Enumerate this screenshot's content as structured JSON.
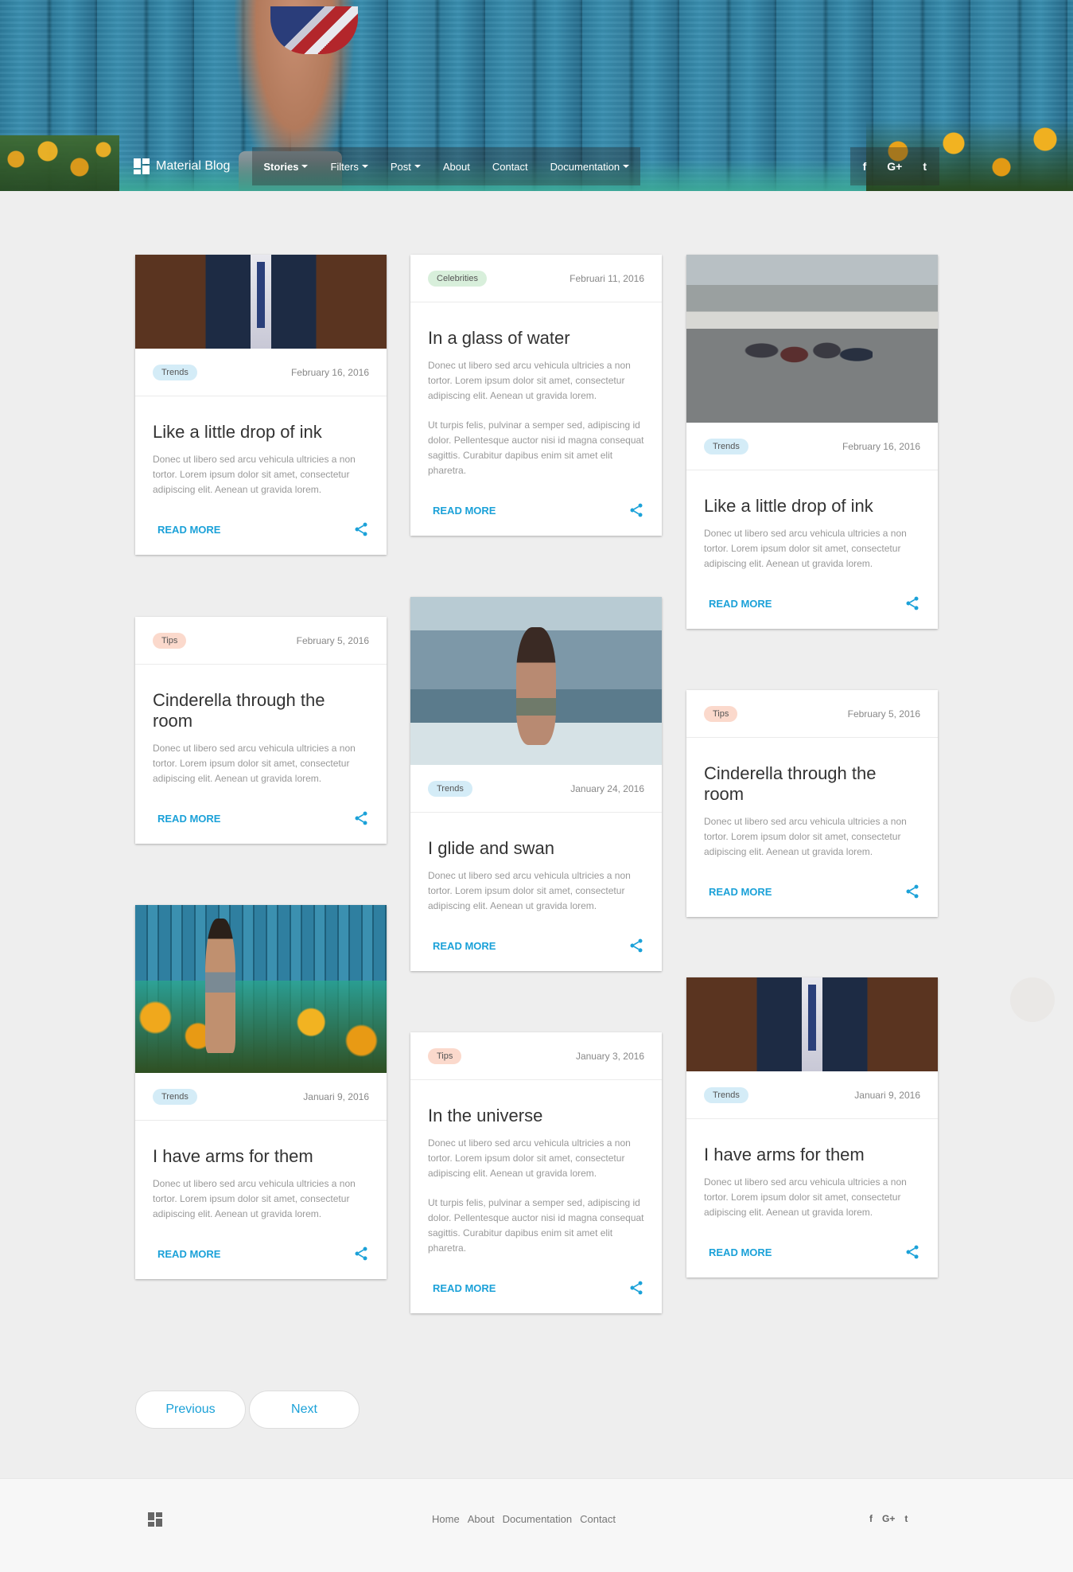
{
  "brand": "Material Blog",
  "nav": [
    {
      "label": "Stories",
      "dropdown": true,
      "active": true
    },
    {
      "label": "Filters",
      "dropdown": true
    },
    {
      "label": "Post",
      "dropdown": true
    },
    {
      "label": "About",
      "dropdown": false
    },
    {
      "label": "Contact",
      "dropdown": false
    },
    {
      "label": "Documentation",
      "dropdown": true
    }
  ],
  "social": [
    "f",
    "G+",
    "t"
  ],
  "colors": {
    "accent": "#1ba1d8",
    "trends": "#d4ecf7",
    "tips": "#fbd9cc",
    "celebrities": "#d8efdb"
  },
  "cards": [
    {
      "category": "Trends",
      "date": "February 16, 2016",
      "title": "Like a little drop of ink",
      "body": [
        "Donec ut libero sed arcu vehicula ultricies a non tortor. Lorem ipsum dolor sit amet, consectetur adipiscing elit. Aenean ut gravida lorem."
      ],
      "read_more": "READ MORE",
      "image": "suit"
    },
    {
      "category": "Tips",
      "date": "February 5, 2016",
      "title": "Cinderella through the room",
      "body": [
        "Donec ut libero sed arcu vehicula ultricies a non tortor. Lorem ipsum dolor sit amet, consectetur adipiscing elit. Aenean ut gravida lorem."
      ],
      "read_more": "READ MORE",
      "image": ""
    },
    {
      "category": "Trends",
      "date": "Januari 9, 2016",
      "title": "I have arms for them",
      "body": [
        "Donec ut libero sed arcu vehicula ultricies a non tortor. Lorem ipsum dolor sit amet, consectetur adipiscing elit. Aenean ut gravida lorem."
      ],
      "read_more": "READ MORE",
      "image": "fence"
    },
    {
      "category": "Celebrities",
      "date": "Februari 11, 2016",
      "title": "In a glass of water",
      "body": [
        "Donec ut libero sed arcu vehicula ultricies a non tortor. Lorem ipsum dolor sit amet, consectetur adipiscing elit. Aenean ut gravida lorem.",
        "Ut turpis felis, pulvinar a semper sed, adipiscing id dolor. Pellentesque auctor nisi id magna consequat sagittis. Curabitur dapibus enim sit amet elit pharetra."
      ],
      "read_more": "READ MORE",
      "image": ""
    },
    {
      "category": "Trends",
      "date": "January 24, 2016",
      "title": "I glide and swan",
      "body": [
        "Donec ut libero sed arcu vehicula ultricies a non tortor. Lorem ipsum dolor sit amet, consectetur adipiscing elit. Aenean ut gravida lorem."
      ],
      "read_more": "READ MORE",
      "image": "sea"
    },
    {
      "category": "Tips",
      "date": "January 3, 2016",
      "title": "In the universe",
      "body": [
        "Donec ut libero sed arcu vehicula ultricies a non tortor. Lorem ipsum dolor sit amet, consectetur adipiscing elit. Aenean ut gravida lorem.",
        "Ut turpis felis, pulvinar a semper sed, adipiscing id dolor. Pellentesque auctor nisi id magna consequat sagittis. Curabitur dapibus enim sit amet elit pharetra."
      ],
      "read_more": "READ MORE",
      "image": ""
    },
    {
      "category": "Trends",
      "date": "February 16, 2016",
      "title": "Like a little drop of ink",
      "body": [
        "Donec ut libero sed arcu vehicula ultricies a non tortor. Lorem ipsum dolor sit amet, consectetur adipiscing elit. Aenean ut gravida lorem."
      ],
      "read_more": "READ MORE",
      "image": "girls"
    },
    {
      "category": "Tips",
      "date": "February 5, 2016",
      "title": "Cinderella through the room",
      "body": [
        "Donec ut libero sed arcu vehicula ultricies a non tortor. Lorem ipsum dolor sit amet, consectetur adipiscing elit. Aenean ut gravida lorem."
      ],
      "read_more": "READ MORE",
      "image": ""
    },
    {
      "category": "Trends",
      "date": "Januari 9, 2016",
      "title": "I have arms for them",
      "body": [
        "Donec ut libero sed arcu vehicula ultricies a non tortor. Lorem ipsum dolor sit amet, consectetur adipiscing elit. Aenean ut gravida lorem."
      ],
      "read_more": "READ MORE",
      "image": "suit"
    }
  ],
  "pagination": {
    "previous": "Previous",
    "next": "Next"
  },
  "footer": {
    "links": [
      "Home",
      "About",
      "Documentation",
      "Contact"
    ],
    "social": [
      "f",
      "G+",
      "t"
    ]
  }
}
